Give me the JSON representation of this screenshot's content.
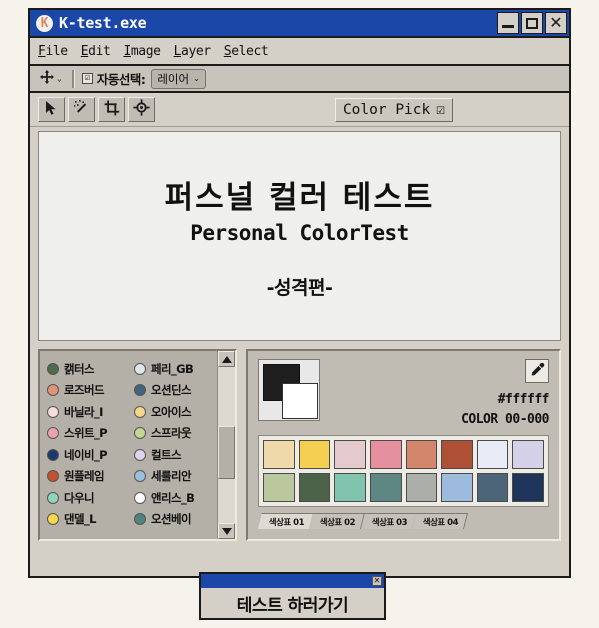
{
  "window": {
    "title": "K-test.exe",
    "icon": "app-k-icon",
    "icon_letter": "K",
    "controls": {
      "minimize": "minimize",
      "maximize": "maximize",
      "close": "close"
    },
    "titlebar_color": "#1a47a8",
    "chrome_color": "#d4d0c8"
  },
  "menubar": {
    "items": [
      {
        "label": "File",
        "accel": "F"
      },
      {
        "label": "Edit",
        "accel": "E"
      },
      {
        "label": "Image",
        "accel": "I"
      },
      {
        "label": "Layer",
        "accel": "L"
      },
      {
        "label": "Select",
        "accel": "S"
      }
    ]
  },
  "options_bar": {
    "move_tool_icon": "move-tool-icon",
    "move_tool_caret": "⌄",
    "auto_select": {
      "checked": true,
      "check_glyph": "☑",
      "label": "자동선택:",
      "value": "레이어",
      "caret": "⌄"
    }
  },
  "toolbar": {
    "tools": [
      {
        "name": "pointer-tool",
        "icon": "arrow-pointer-icon"
      },
      {
        "name": "magic-wand-tool",
        "icon": "magic-wand-icon"
      },
      {
        "name": "crop-tool",
        "icon": "crop-icon"
      },
      {
        "name": "target-move-tool",
        "icon": "target-icon"
      }
    ],
    "color_pick": {
      "label": "Color Pick",
      "check_glyph": "☑"
    }
  },
  "canvas": {
    "title_kr": "퍼스널 컬러 테스트",
    "title_en": "Personal ColorTest",
    "subtitle": "-성격편-",
    "background": "#efefed"
  },
  "color_list": {
    "items": [
      {
        "label": "캙터스",
        "color": "#4e6b4a"
      },
      {
        "label": "페리_GB",
        "color": "#dde6ea"
      },
      {
        "label": "로즈버드",
        "color": "#e09176"
      },
      {
        "label": "오션딘스",
        "color": "#3f6580"
      },
      {
        "label": "바닐라_I",
        "color": "#f6dcdc"
      },
      {
        "label": "오아이스",
        "color": "#f5d68e"
      },
      {
        "label": "스위트_P",
        "color": "#eda0b0"
      },
      {
        "label": "스프라웃",
        "color": "#c3d693"
      },
      {
        "label": "네이비_P",
        "color": "#1b3a6b"
      },
      {
        "label": "컬트스",
        "color": "#ddd4ee"
      },
      {
        "label": "원플레임",
        "color": "#c4522f"
      },
      {
        "label": "세룰리안",
        "color": "#9dbfe0"
      },
      {
        "label": "다우니",
        "color": "#8fd5bd"
      },
      {
        "label": "앤리스_B",
        "color": "#ffffff"
      },
      {
        "label": "댄델_L",
        "color": "#f7d84a"
      },
      {
        "label": "오션베이",
        "color": "#51837f"
      }
    ],
    "scrollbar": {
      "up": "▲",
      "down": "▼"
    }
  },
  "palette": {
    "foreground": "#1e1e1e",
    "background": "#ffffff",
    "eyedropper_icon": "eyedropper-icon",
    "hex_value": "#ffffff",
    "color_code": "COLOR 00-000",
    "swatch_rows": [
      [
        "#efd9a9",
        "#f5cf52",
        "#e3cbcd",
        "#e6909f",
        "#d3866c",
        "#ad5035",
        "#e8ecf7",
        "#d4d0e6"
      ],
      [
        "#bbc79d",
        "#4d6349",
        "#80c3ae",
        "#5e8682",
        "#acaeaa",
        "#9cbbdd",
        "#4c6579",
        "#1e3459"
      ]
    ],
    "tabs": [
      {
        "label": "색상표 01",
        "active": true
      },
      {
        "label": "색상표 02",
        "active": false
      },
      {
        "label": "색상표 03",
        "active": false
      },
      {
        "label": "색상표 04",
        "active": false
      }
    ]
  },
  "dialog": {
    "button_label": "테스트 하러가기",
    "close_glyph": "✕"
  }
}
